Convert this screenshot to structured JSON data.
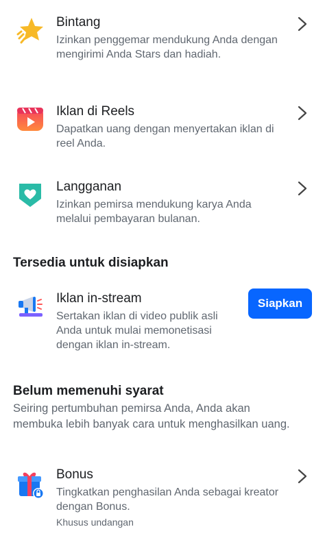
{
  "items": [
    {
      "title": "Bintang",
      "desc": "Izinkan penggemar mendukung Anda dengan mengirimi Anda Stars dan hadiah.",
      "icon": "star-icon"
    },
    {
      "title": "Iklan di Reels",
      "desc": "Dapatkan uang dengan menyertakan iklan di reel Anda.",
      "icon": "reels-icon"
    },
    {
      "title": "Langganan",
      "desc": "Izinkan pemirsa mendukung karya Anda melalui pembayaran bulanan.",
      "icon": "subscription-heart-icon"
    }
  ],
  "available": {
    "heading": "Tersedia untuk disiapkan",
    "item": {
      "title": "Iklan in-stream",
      "desc": "Sertakan iklan di video publik asli Anda untuk mulai memonetisasi dengan iklan in-stream.",
      "button": "Siapkan",
      "icon": "megaphone-icon"
    }
  },
  "not_eligible": {
    "heading": "Belum memenuhi syarat",
    "subtext": "Seiring pertumbuhan pemirsa Anda, Anda akan membuka lebih banyak cara untuk menghasilkan uang.",
    "item": {
      "title": "Bonus",
      "desc": "Tingkatkan penghasilan Anda sebagai kreator dengan Bonus.",
      "note": "Khusus undangan",
      "icon": "gift-lock-icon"
    }
  }
}
